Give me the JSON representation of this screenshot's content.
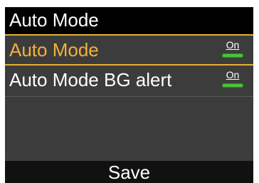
{
  "header": {
    "title": "Auto Mode"
  },
  "menu": {
    "items": [
      {
        "label": "Auto Mode",
        "state_text": "On",
        "state": "on",
        "selected": true
      },
      {
        "label": "Auto Mode BG alert",
        "state_text": "On",
        "state": "on",
        "selected": false
      }
    ]
  },
  "footer": {
    "save_label": "Save"
  },
  "colors": {
    "background": "#3c3c3c",
    "title_bar": "#000000",
    "selected_accent": "#f2b13a",
    "toggle_on": "#49c23a",
    "footer_bar": "#111111",
    "text": "#ffffff"
  }
}
